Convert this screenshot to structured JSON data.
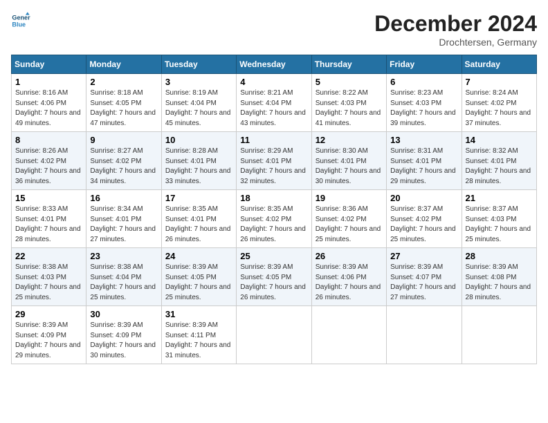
{
  "header": {
    "logo_line1": "General",
    "logo_line2": "Blue",
    "month_title": "December 2024",
    "location": "Drochtersen, Germany"
  },
  "weekdays": [
    "Sunday",
    "Monday",
    "Tuesday",
    "Wednesday",
    "Thursday",
    "Friday",
    "Saturday"
  ],
  "weeks": [
    [
      {
        "day": "1",
        "sunrise": "8:16 AM",
        "sunset": "4:06 PM",
        "daylight": "7 hours and 49 minutes."
      },
      {
        "day": "2",
        "sunrise": "8:18 AM",
        "sunset": "4:05 PM",
        "daylight": "7 hours and 47 minutes."
      },
      {
        "day": "3",
        "sunrise": "8:19 AM",
        "sunset": "4:04 PM",
        "daylight": "7 hours and 45 minutes."
      },
      {
        "day": "4",
        "sunrise": "8:21 AM",
        "sunset": "4:04 PM",
        "daylight": "7 hours and 43 minutes."
      },
      {
        "day": "5",
        "sunrise": "8:22 AM",
        "sunset": "4:03 PM",
        "daylight": "7 hours and 41 minutes."
      },
      {
        "day": "6",
        "sunrise": "8:23 AM",
        "sunset": "4:03 PM",
        "daylight": "7 hours and 39 minutes."
      },
      {
        "day": "7",
        "sunrise": "8:24 AM",
        "sunset": "4:02 PM",
        "daylight": "7 hours and 37 minutes."
      }
    ],
    [
      {
        "day": "8",
        "sunrise": "8:26 AM",
        "sunset": "4:02 PM",
        "daylight": "7 hours and 36 minutes."
      },
      {
        "day": "9",
        "sunrise": "8:27 AM",
        "sunset": "4:02 PM",
        "daylight": "7 hours and 34 minutes."
      },
      {
        "day": "10",
        "sunrise": "8:28 AM",
        "sunset": "4:01 PM",
        "daylight": "7 hours and 33 minutes."
      },
      {
        "day": "11",
        "sunrise": "8:29 AM",
        "sunset": "4:01 PM",
        "daylight": "7 hours and 32 minutes."
      },
      {
        "day": "12",
        "sunrise": "8:30 AM",
        "sunset": "4:01 PM",
        "daylight": "7 hours and 30 minutes."
      },
      {
        "day": "13",
        "sunrise": "8:31 AM",
        "sunset": "4:01 PM",
        "daylight": "7 hours and 29 minutes."
      },
      {
        "day": "14",
        "sunrise": "8:32 AM",
        "sunset": "4:01 PM",
        "daylight": "7 hours and 28 minutes."
      }
    ],
    [
      {
        "day": "15",
        "sunrise": "8:33 AM",
        "sunset": "4:01 PM",
        "daylight": "7 hours and 28 minutes."
      },
      {
        "day": "16",
        "sunrise": "8:34 AM",
        "sunset": "4:01 PM",
        "daylight": "7 hours and 27 minutes."
      },
      {
        "day": "17",
        "sunrise": "8:35 AM",
        "sunset": "4:01 PM",
        "daylight": "7 hours and 26 minutes."
      },
      {
        "day": "18",
        "sunrise": "8:35 AM",
        "sunset": "4:02 PM",
        "daylight": "7 hours and 26 minutes."
      },
      {
        "day": "19",
        "sunrise": "8:36 AM",
        "sunset": "4:02 PM",
        "daylight": "7 hours and 25 minutes."
      },
      {
        "day": "20",
        "sunrise": "8:37 AM",
        "sunset": "4:02 PM",
        "daylight": "7 hours and 25 minutes."
      },
      {
        "day": "21",
        "sunrise": "8:37 AM",
        "sunset": "4:03 PM",
        "daylight": "7 hours and 25 minutes."
      }
    ],
    [
      {
        "day": "22",
        "sunrise": "8:38 AM",
        "sunset": "4:03 PM",
        "daylight": "7 hours and 25 minutes."
      },
      {
        "day": "23",
        "sunrise": "8:38 AM",
        "sunset": "4:04 PM",
        "daylight": "7 hours and 25 minutes."
      },
      {
        "day": "24",
        "sunrise": "8:39 AM",
        "sunset": "4:05 PM",
        "daylight": "7 hours and 25 minutes."
      },
      {
        "day": "25",
        "sunrise": "8:39 AM",
        "sunset": "4:05 PM",
        "daylight": "7 hours and 26 minutes."
      },
      {
        "day": "26",
        "sunrise": "8:39 AM",
        "sunset": "4:06 PM",
        "daylight": "7 hours and 26 minutes."
      },
      {
        "day": "27",
        "sunrise": "8:39 AM",
        "sunset": "4:07 PM",
        "daylight": "7 hours and 27 minutes."
      },
      {
        "day": "28",
        "sunrise": "8:39 AM",
        "sunset": "4:08 PM",
        "daylight": "7 hours and 28 minutes."
      }
    ],
    [
      {
        "day": "29",
        "sunrise": "8:39 AM",
        "sunset": "4:09 PM",
        "daylight": "7 hours and 29 minutes."
      },
      {
        "day": "30",
        "sunrise": "8:39 AM",
        "sunset": "4:09 PM",
        "daylight": "7 hours and 30 minutes."
      },
      {
        "day": "31",
        "sunrise": "8:39 AM",
        "sunset": "4:11 PM",
        "daylight": "7 hours and 31 minutes."
      },
      null,
      null,
      null,
      null
    ]
  ],
  "labels": {
    "sunrise": "Sunrise:",
    "sunset": "Sunset:",
    "daylight": "Daylight:"
  }
}
